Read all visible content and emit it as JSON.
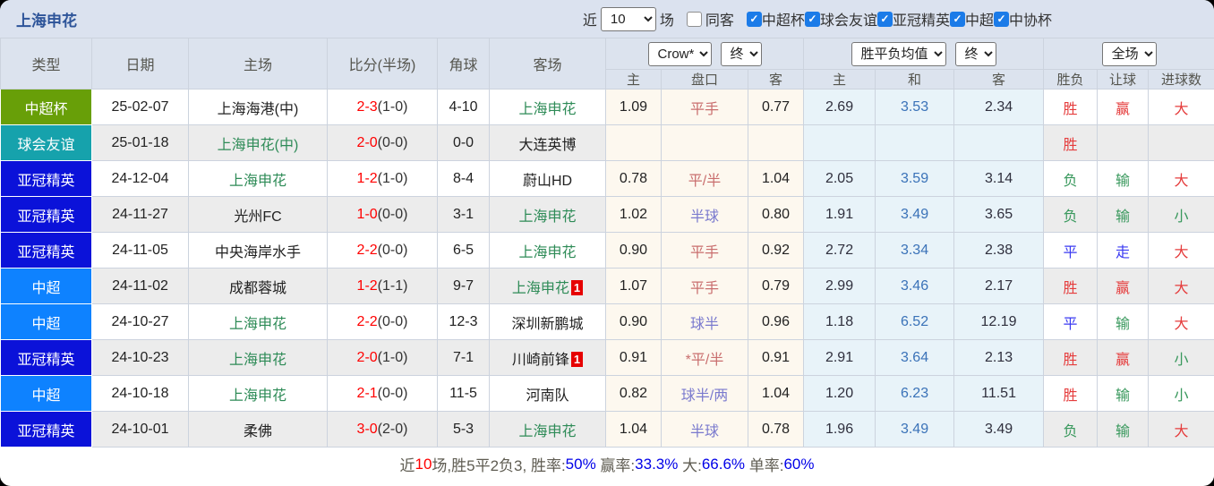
{
  "topbar": {
    "title": "上海申花",
    "recent_label": "近",
    "recent_value": "10",
    "games_label": "场",
    "same_away_label": "同客",
    "same_away_checked": false,
    "league_filters": [
      {
        "label": "中超杯",
        "checked": true
      },
      {
        "label": "球会友谊",
        "checked": true
      },
      {
        "label": "亚冠精英",
        "checked": true
      },
      {
        "label": "中超",
        "checked": true
      },
      {
        "label": "中协杯",
        "checked": true
      }
    ]
  },
  "header": {
    "cols": [
      "类型",
      "日期",
      "主场",
      "比分(半场)",
      "角球",
      "客场"
    ],
    "bookmaker_select": "Crow*",
    "ah_state_select": "终",
    "avg_select": "胜平负均值",
    "avg_state_select": "终",
    "scope_select": "全场",
    "sub": [
      "主",
      "盘口",
      "客",
      "主",
      "和",
      "客",
      "胜负",
      "让球",
      "进球数"
    ]
  },
  "type_colors": {
    "中超杯": "#689F08",
    "球会友谊": "#16A2AC",
    "亚冠精英": "#0B12D9",
    "中超": "#0E82FF"
  },
  "rows": [
    {
      "type": "中超杯",
      "date": "25-02-07",
      "home": "上海海港(中)",
      "home_color": "black",
      "score": "2-3",
      "half": "(1-0)",
      "corner": "4-10",
      "away": "上海申花",
      "away_color": "green",
      "away_badge": "",
      "ah_home": "1.09",
      "line": "平手",
      "line_color": "red",
      "ah_away": "0.77",
      "avg_home": "2.69",
      "avg_draw": "3.53",
      "avg_away": "2.34",
      "result": "胜",
      "result_color": "red",
      "handicap": "赢",
      "handicap_color": "red",
      "goals": "大",
      "goals_color": "red"
    },
    {
      "type": "球会友谊",
      "date": "25-01-18",
      "home": "上海申花(中)",
      "home_color": "green",
      "score": "2-0",
      "half": "(0-0)",
      "corner": "0-0",
      "away": "大连英博",
      "away_color": "black",
      "away_badge": "",
      "ah_home": "",
      "line": "",
      "line_color": "red",
      "ah_away": "",
      "avg_home": "",
      "avg_draw": "",
      "avg_away": "",
      "result": "胜",
      "result_color": "red",
      "handicap": "",
      "handicap_color": "red",
      "goals": "",
      "goals_color": "red"
    },
    {
      "type": "亚冠精英",
      "date": "24-12-04",
      "home": "上海申花",
      "home_color": "green",
      "score": "1-2",
      "half": "(1-0)",
      "corner": "8-4",
      "away": "蔚山HD",
      "away_color": "black",
      "away_badge": "",
      "ah_home": "0.78",
      "line": "平/半",
      "line_color": "red",
      "ah_away": "1.04",
      "avg_home": "2.05",
      "avg_draw": "3.59",
      "avg_away": "3.14",
      "result": "负",
      "result_color": "green",
      "handicap": "输",
      "handicap_color": "green",
      "goals": "大",
      "goals_color": "red"
    },
    {
      "type": "亚冠精英",
      "date": "24-11-27",
      "home": "光州FC",
      "home_color": "black",
      "score": "1-0",
      "half": "(0-0)",
      "corner": "3-1",
      "away": "上海申花",
      "away_color": "green",
      "away_badge": "",
      "ah_home": "1.02",
      "line": "半球",
      "line_color": "blue",
      "ah_away": "0.80",
      "avg_home": "1.91",
      "avg_draw": "3.49",
      "avg_away": "3.65",
      "result": "负",
      "result_color": "green",
      "handicap": "输",
      "handicap_color": "green",
      "goals": "小",
      "goals_color": "green"
    },
    {
      "type": "亚冠精英",
      "date": "24-11-05",
      "home": "中央海岸水手",
      "home_color": "black",
      "score": "2-2",
      "half": "(0-0)",
      "corner": "6-5",
      "away": "上海申花",
      "away_color": "green",
      "away_badge": "",
      "ah_home": "0.90",
      "line": "平手",
      "line_color": "red",
      "ah_away": "0.92",
      "avg_home": "2.72",
      "avg_draw": "3.34",
      "avg_away": "2.38",
      "result": "平",
      "result_color": "blue",
      "handicap": "走",
      "handicap_color": "blue",
      "goals": "大",
      "goals_color": "red"
    },
    {
      "type": "中超",
      "date": "24-11-02",
      "home": "成都蓉城",
      "home_color": "black",
      "score": "1-2",
      "half": "(1-1)",
      "corner": "9-7",
      "away": "上海申花",
      "away_color": "green",
      "away_badge": "1",
      "ah_home": "1.07",
      "line": "平手",
      "line_color": "red",
      "ah_away": "0.79",
      "avg_home": "2.99",
      "avg_draw": "3.46",
      "avg_away": "2.17",
      "result": "胜",
      "result_color": "red",
      "handicap": "赢",
      "handicap_color": "red",
      "goals": "大",
      "goals_color": "red"
    },
    {
      "type": "中超",
      "date": "24-10-27",
      "home": "上海申花",
      "home_color": "green",
      "score": "2-2",
      "half": "(0-0)",
      "corner": "12-3",
      "away": "深圳新鹏城",
      "away_color": "black",
      "away_badge": "",
      "ah_home": "0.90",
      "line": "球半",
      "line_color": "blue",
      "ah_away": "0.96",
      "avg_home": "1.18",
      "avg_draw": "6.52",
      "avg_away": "12.19",
      "result": "平",
      "result_color": "blue",
      "handicap": "输",
      "handicap_color": "green",
      "goals": "大",
      "goals_color": "red"
    },
    {
      "type": "亚冠精英",
      "date": "24-10-23",
      "home": "上海申花",
      "home_color": "green",
      "score": "2-0",
      "half": "(1-0)",
      "corner": "7-1",
      "away": "川崎前锋",
      "away_color": "black",
      "away_badge": "1",
      "ah_home": "0.91",
      "line": "*平/半",
      "line_color": "red",
      "ah_away": "0.91",
      "avg_home": "2.91",
      "avg_draw": "3.64",
      "avg_away": "2.13",
      "result": "胜",
      "result_color": "red",
      "handicap": "赢",
      "handicap_color": "red",
      "goals": "小",
      "goals_color": "green"
    },
    {
      "type": "中超",
      "date": "24-10-18",
      "home": "上海申花",
      "home_color": "green",
      "score": "2-1",
      "half": "(0-0)",
      "corner": "11-5",
      "away": "河南队",
      "away_color": "black",
      "away_badge": "",
      "ah_home": "0.82",
      "line": "球半/两",
      "line_color": "blue",
      "ah_away": "1.04",
      "avg_home": "1.20",
      "avg_draw": "6.23",
      "avg_away": "11.51",
      "result": "胜",
      "result_color": "red",
      "handicap": "输",
      "handicap_color": "green",
      "goals": "小",
      "goals_color": "green"
    },
    {
      "type": "亚冠精英",
      "date": "24-10-01",
      "home": "柔佛",
      "home_color": "black",
      "score": "3-0",
      "half": "(2-0)",
      "corner": "5-3",
      "away": "上海申花",
      "away_color": "green",
      "away_badge": "",
      "ah_home": "1.04",
      "line": "半球",
      "line_color": "blue",
      "ah_away": "0.78",
      "avg_home": "1.96",
      "avg_draw": "3.49",
      "avg_away": "3.49",
      "result": "负",
      "result_color": "green",
      "handicap": "输",
      "handicap_color": "green",
      "goals": "大",
      "goals_color": "red"
    }
  ],
  "summary": {
    "segments": [
      {
        "text": "近",
        "color": "label"
      },
      {
        "text": "10",
        "color": "red"
      },
      {
        "text": "场,胜5平2负3, 胜率:",
        "color": "label"
      },
      {
        "text": "50%",
        "color": "blue"
      },
      {
        "text": " 赢率:",
        "color": "label"
      },
      {
        "text": "33.3%",
        "color": "blue"
      },
      {
        "text": " 大:",
        "color": "label"
      },
      {
        "text": "66.6%",
        "color": "blue"
      },
      {
        "text": " 单率:",
        "color": "label"
      },
      {
        "text": "60%",
        "color": "blue"
      }
    ]
  }
}
